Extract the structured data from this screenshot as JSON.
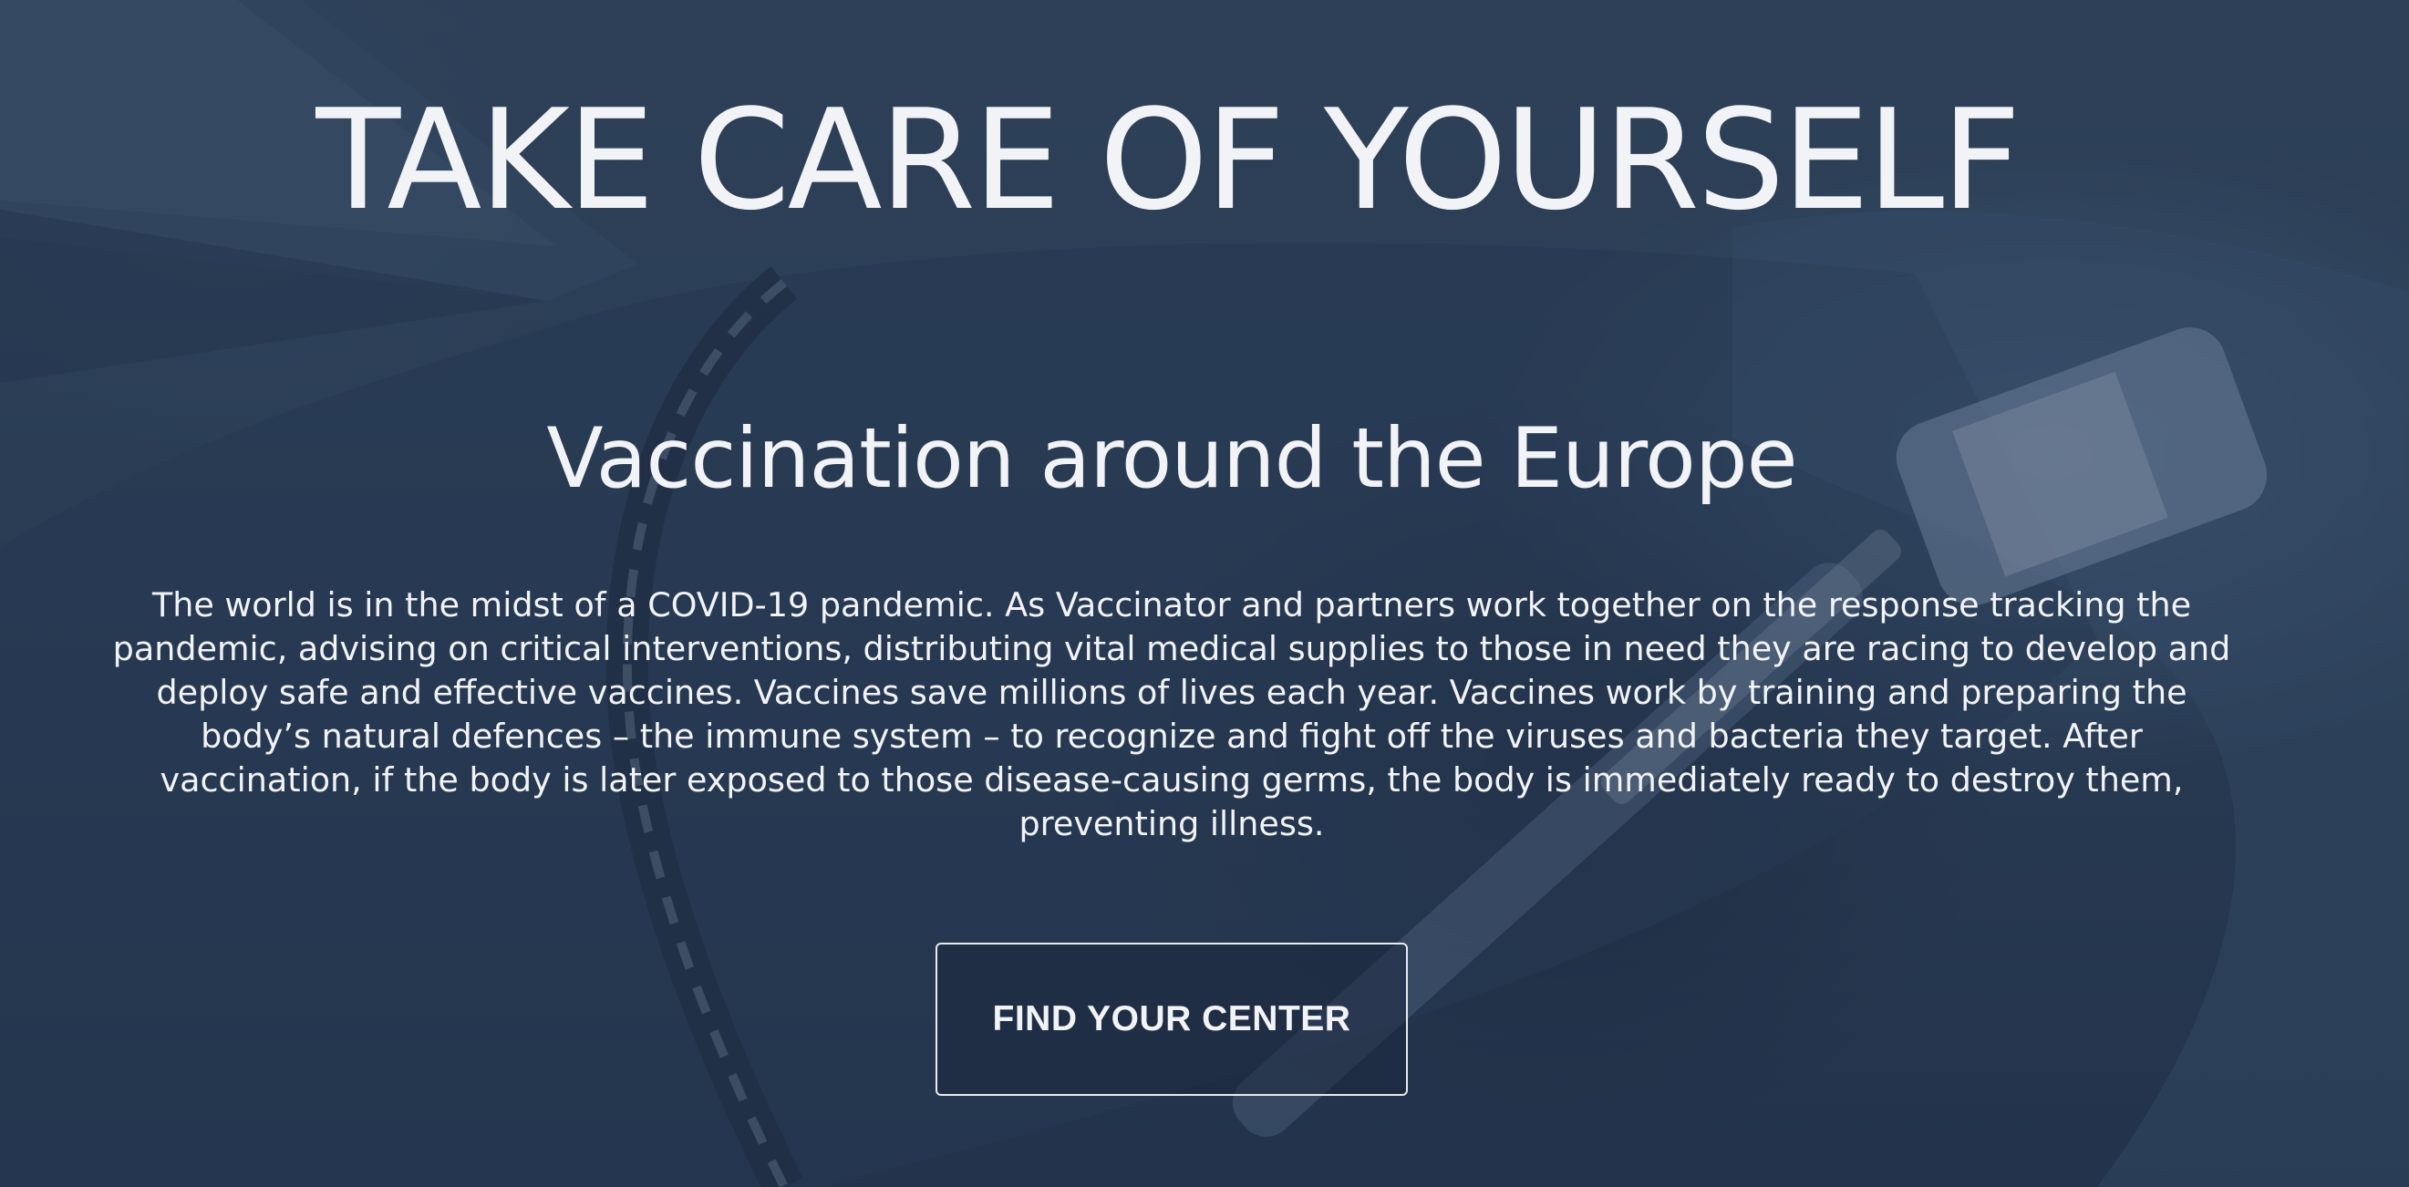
{
  "hero": {
    "title": "TAKE CARE OF YOURSELF",
    "subtitle": "Vaccination around the Europe",
    "description": "The world is in the midst of a COVID-19 pandemic. As Vaccinator and partners work together on the response tracking the pandemic, advising on critical interventions, distributing vital medical supplies to those in need they are racing to develop and deploy safe and effective vaccines. Vaccines save millions of lives each year. Vaccines work by training and preparing the body’s natural defences – the immune system – to recognize and fight off the viruses and bacteria they target. After vaccination, if the body is later exposed to those disease-causing germs, the body is immediately ready to destroy them, preventing illness.",
    "cta_label": "FIND YOUR CENTER"
  },
  "colors": {
    "overlay": "#2d4159",
    "text": "#f2f3f6",
    "button_border": "#e8ebf0"
  }
}
